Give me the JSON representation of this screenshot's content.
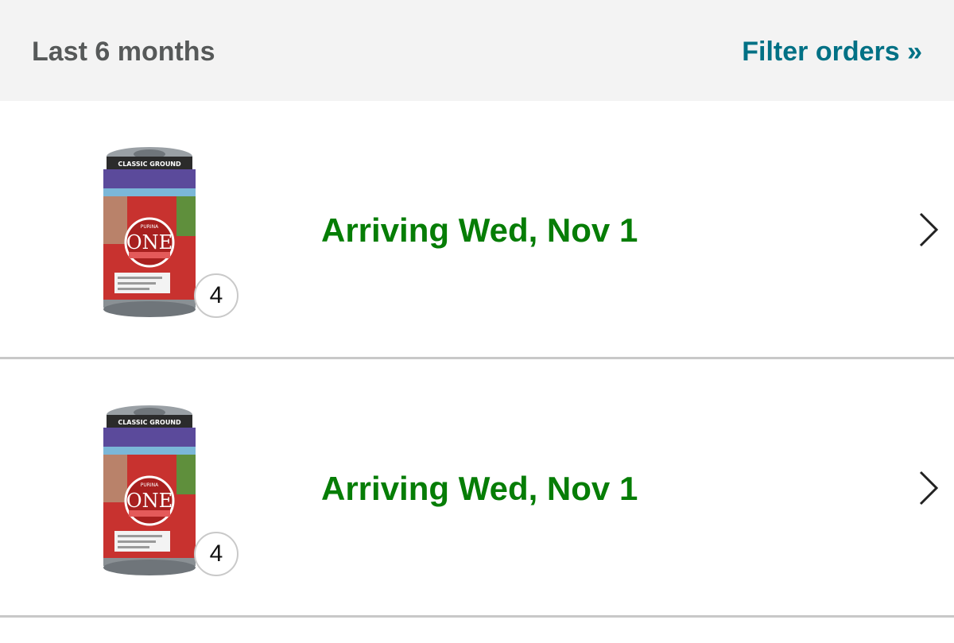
{
  "header": {
    "period_label": "Last 6 months",
    "filter_label": "Filter orders »"
  },
  "orders": [
    {
      "product": {
        "brand": "PURINA",
        "logo": "ONE",
        "band_text": "CLASSIC GROUND"
      },
      "quantity": "4",
      "status": "Arriving Wed, Nov 1"
    },
    {
      "product": {
        "brand": "PURINA",
        "logo": "ONE",
        "band_text": "CLASSIC GROUND"
      },
      "quantity": "4",
      "status": "Arriving Wed, Nov 1"
    }
  ],
  "colors": {
    "header_bg": "#f3f3f3",
    "header_text": "#565959",
    "link": "#007185",
    "arrival_green": "#067d06",
    "divider": "#c8c8c8",
    "can_red": "#c8322f",
    "can_purple": "#5b4a9b"
  },
  "icons": {
    "row_chevron": "chevron-right-icon"
  }
}
